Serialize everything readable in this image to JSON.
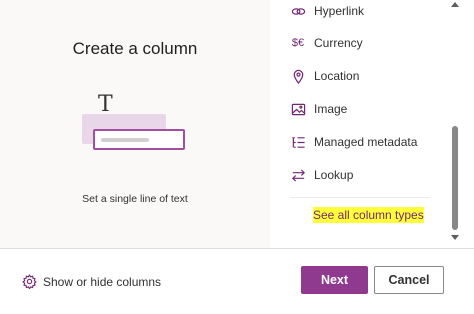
{
  "preview": {
    "title": "Create a column",
    "glyph": "T",
    "description": "Set a single line of text"
  },
  "column_types": [
    {
      "label": "Hyperlink",
      "icon": "link-icon"
    },
    {
      "label": "Currency",
      "icon": "currency-icon",
      "glyph": "$€"
    },
    {
      "label": "Location",
      "icon": "location-pin-icon"
    },
    {
      "label": "Image",
      "icon": "image-icon"
    },
    {
      "label": "Managed metadata",
      "icon": "metadata-icon"
    },
    {
      "label": "Lookup",
      "icon": "lookup-arrows-icon"
    }
  ],
  "see_all_label": "See all column types",
  "footer": {
    "show_hide_label": "Show or hide columns",
    "next_label": "Next",
    "cancel_label": "Cancel"
  },
  "colors": {
    "accent": "#742774",
    "primary_button": "#8f3a8f",
    "highlight": "#ffff3a",
    "illustration_back": "#e9d7e9"
  }
}
